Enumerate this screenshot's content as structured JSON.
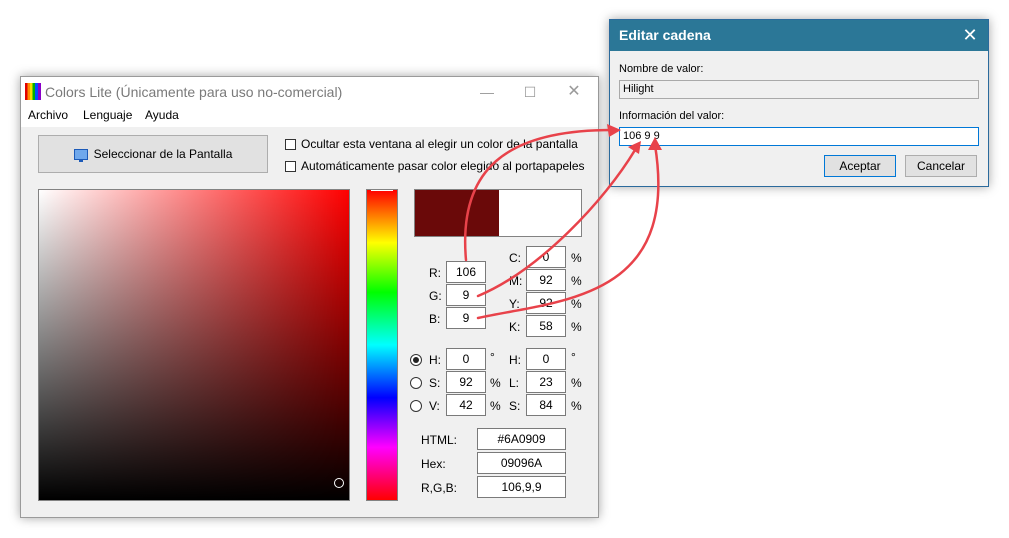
{
  "main_window": {
    "title": "Colors Lite (Únicamente para uso no-comercial)",
    "menu": [
      "Archivo",
      "Lenguaje",
      "Ayuda"
    ],
    "select_screen_button": "Seleccionar de la Pantalla",
    "checkbox_hide": "Ocultar esta ventana al elegir un color de la pantalla",
    "checkbox_clipboard": "Automáticamente pasar color elegido al portapapeles",
    "rgb": {
      "r_label": "R:",
      "r": "106",
      "g_label": "G:",
      "g": "9",
      "b_label": "B:",
      "b": "9"
    },
    "cmyk": {
      "c_label": "C:",
      "c": "0",
      "m_label": "M:",
      "m": "92",
      "y_label": "Y:",
      "y": "92",
      "k_label": "K:",
      "k": "58",
      "unit": "%"
    },
    "hsv": {
      "h_label": "H:",
      "h": "0",
      "h_unit": "°",
      "s_label": "S:",
      "s": "92",
      "s_unit": "%",
      "v_label": "V:",
      "v": "42",
      "v_unit": "%",
      "selected": "H"
    },
    "hsl": {
      "h_label": "H:",
      "h": "0",
      "h_unit": "°",
      "l_label": "L:",
      "l": "23",
      "l_unit": "%",
      "s_label": "S:",
      "s": "84",
      "s_unit": "%"
    },
    "codes": {
      "html_label": "HTML:",
      "html": "#6A0909",
      "hex_label": "Hex:",
      "hex": "09096A",
      "rgb_label": "R,G,B:",
      "rgb": "106,9,9"
    },
    "preview_color": "#6A0909"
  },
  "edit_dialog": {
    "title": "Editar cadena",
    "value_name_label": "Nombre de valor:",
    "value_name": "Hilight",
    "value_data_label": "Información del valor:",
    "value_data": "106 9 9",
    "accept_button": "Aceptar",
    "cancel_button": "Cancelar"
  },
  "colors": {
    "arrow": "#e8424a",
    "dialog_title_bar": "#2b7797",
    "accent_border": "#0078d7"
  }
}
